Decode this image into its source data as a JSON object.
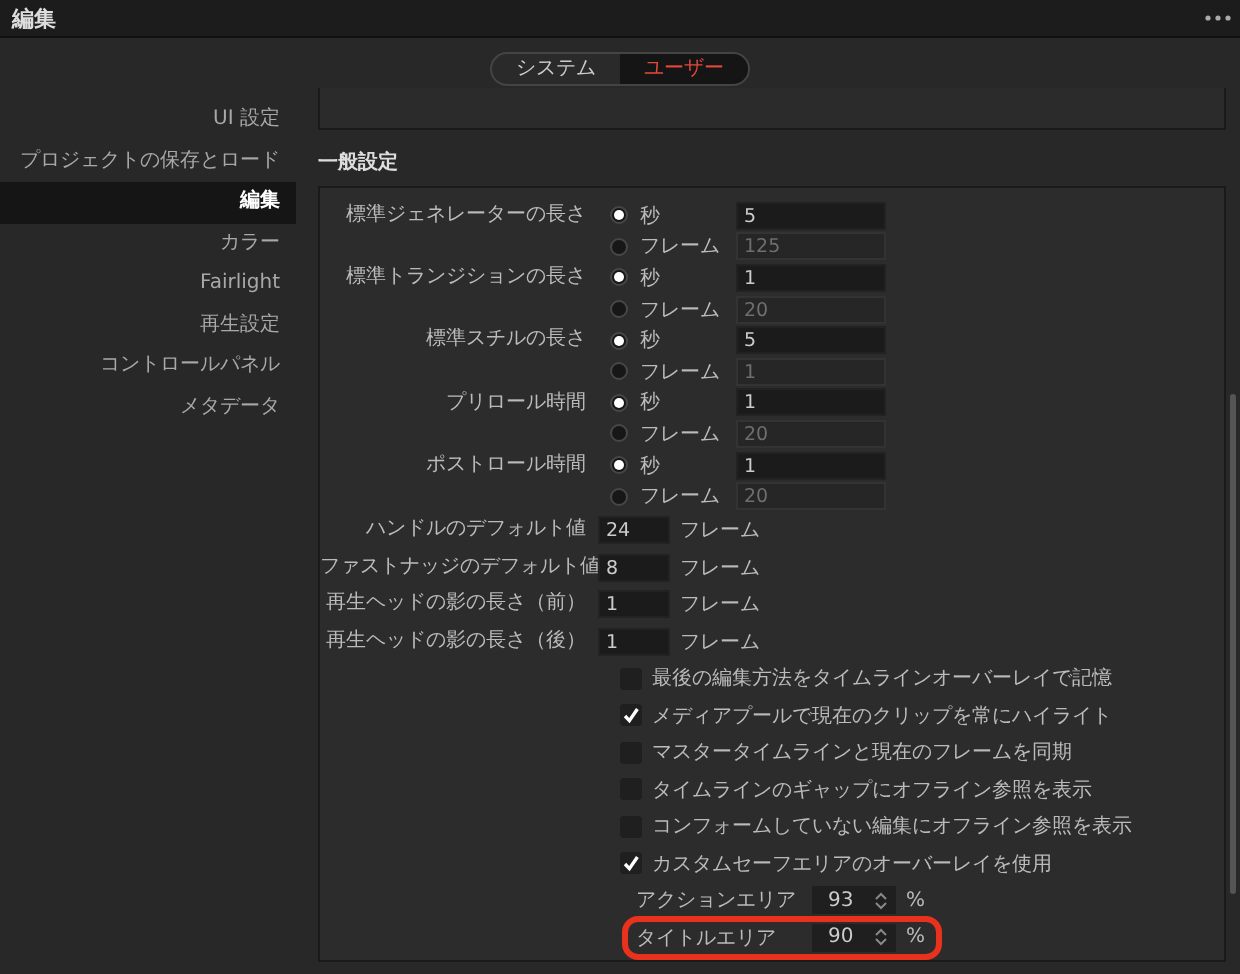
{
  "window": {
    "title": "編集"
  },
  "tabs": [
    {
      "label": "システム",
      "selected": false
    },
    {
      "label": "ユーザー",
      "selected": true
    }
  ],
  "sidebar": {
    "items": [
      {
        "label": "UI 設定",
        "selected": false
      },
      {
        "label": "プロジェクトの保存とロード",
        "selected": false
      },
      {
        "label": "編集",
        "selected": true
      },
      {
        "label": "カラー",
        "selected": false
      },
      {
        "label": "Fairlight",
        "selected": false
      },
      {
        "label": "再生設定",
        "selected": false
      },
      {
        "label": "コントロールパネル",
        "selected": false
      },
      {
        "label": "メタデータ",
        "selected": false
      }
    ]
  },
  "section_title": "一般設定",
  "durations": [
    {
      "label": "標準ジェネレーターの長さ",
      "options": [
        {
          "label": "秒",
          "selected": true,
          "value": "5"
        },
        {
          "label": "フレーム",
          "selected": false,
          "value": "125"
        }
      ]
    },
    {
      "label": "標準トランジションの長さ",
      "options": [
        {
          "label": "秒",
          "selected": true,
          "value": "1"
        },
        {
          "label": "フレーム",
          "selected": false,
          "value": "20"
        }
      ]
    },
    {
      "label": "標準スチルの長さ",
      "options": [
        {
          "label": "秒",
          "selected": true,
          "value": "5"
        },
        {
          "label": "フレーム",
          "selected": false,
          "value": "1"
        }
      ]
    },
    {
      "label": "プリロール時間",
      "options": [
        {
          "label": "秒",
          "selected": true,
          "value": "1"
        },
        {
          "label": "フレーム",
          "selected": false,
          "value": "20"
        }
      ]
    },
    {
      "label": "ポストロール時間",
      "options": [
        {
          "label": "秒",
          "selected": true,
          "value": "1"
        },
        {
          "label": "フレーム",
          "selected": false,
          "value": "20"
        }
      ]
    }
  ],
  "frame_fields": [
    {
      "label": "ハンドルのデフォルト値",
      "value": "24",
      "unit": "フレーム"
    },
    {
      "label": "ファストナッジのデフォルト値",
      "value": "8",
      "unit": "フレーム"
    },
    {
      "label": "再生ヘッドの影の長さ（前）",
      "value": "1",
      "unit": "フレーム"
    },
    {
      "label": "再生ヘッドの影の長さ（後）",
      "value": "1",
      "unit": "フレーム"
    }
  ],
  "checkboxes": [
    {
      "label": "最後の編集方法をタイムラインオーバーレイで記憶",
      "checked": false
    },
    {
      "label": "メディアプールで現在のクリップを常にハイライト",
      "checked": true
    },
    {
      "label": "マスタータイムラインと現在のフレームを同期",
      "checked": false
    },
    {
      "label": "タイムラインのギャップにオフライン参照を表示",
      "checked": false
    },
    {
      "label": "コンフォームしていない編集にオフライン参照を表示",
      "checked": false
    },
    {
      "label": "カスタムセーフエリアのオーバーレイを使用",
      "checked": true
    }
  ],
  "safe_areas": [
    {
      "label": "アクションエリア",
      "value": "93",
      "unit": "%",
      "highlighted": false
    },
    {
      "label": "タイトルエリア",
      "value": "90",
      "unit": "%",
      "highlighted": true
    }
  ]
}
